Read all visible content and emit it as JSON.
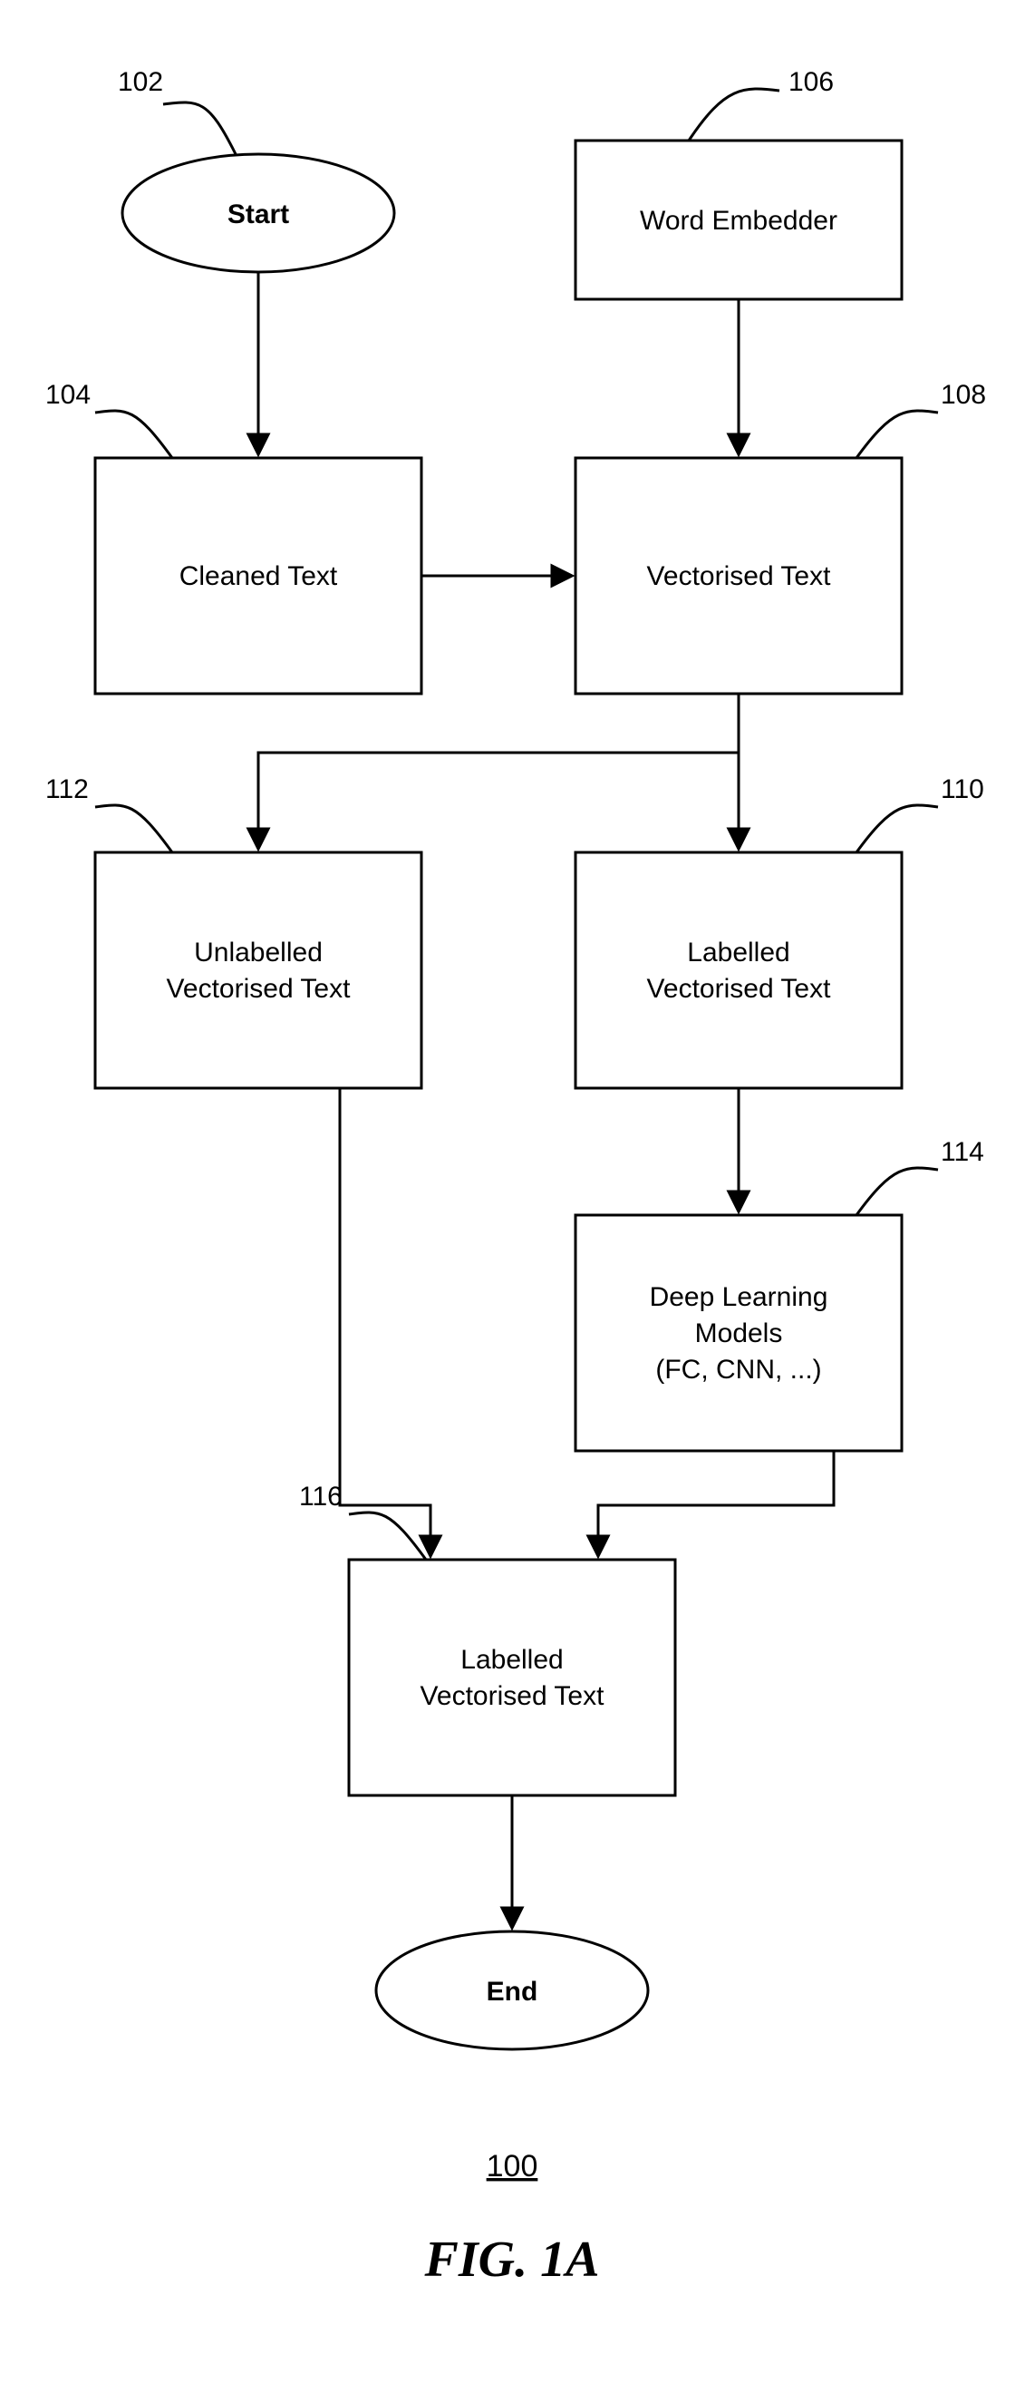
{
  "nodes": {
    "start": {
      "label": "Start",
      "ref": "102"
    },
    "cleaned": {
      "label": "Cleaned Text",
      "ref": "104"
    },
    "embedder": {
      "label": "Word Embedder",
      "ref": "106"
    },
    "vectorised": {
      "label": "Vectorised Text",
      "ref": "108"
    },
    "labelled": {
      "label": "Labelled",
      "label2": "Vectorised Text",
      "ref": "110"
    },
    "unlabelled": {
      "label": "Unlabelled",
      "label2": "Vectorised Text",
      "ref": "112"
    },
    "models": {
      "label": "Deep Learning",
      "label2": "Models",
      "label3": "(FC, CNN, ...)",
      "ref": "114"
    },
    "outLabelled": {
      "label": "Labelled",
      "label2": "Vectorised Text",
      "ref": "116"
    },
    "end": {
      "label": "End"
    }
  },
  "figure": {
    "number": "100",
    "label": "FIG. 1A"
  }
}
